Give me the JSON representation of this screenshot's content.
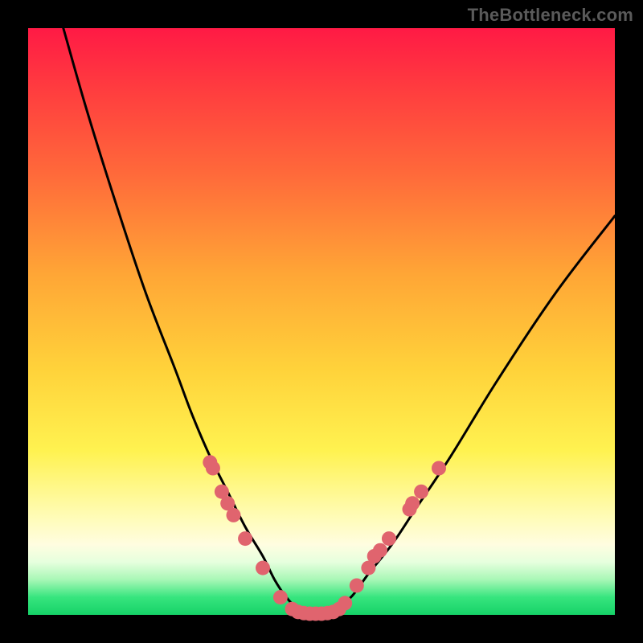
{
  "watermark": "TheBottleneck.com",
  "colors": {
    "background": "#000000",
    "dot": "#e0646e",
    "curve": "#000000"
  },
  "chart_data": {
    "type": "line",
    "title": "",
    "xlabel": "",
    "ylabel": "",
    "xlim": [
      0,
      100
    ],
    "ylim": [
      0,
      100
    ],
    "note": "No axis ticks or numeric labels are rendered in the image; values are visual-position estimates on a 0–100 scale.",
    "series": [
      {
        "name": "curve",
        "x": [
          6,
          10,
          15,
          20,
          25,
          28,
          31,
          34,
          37,
          40,
          42,
          44,
          46,
          48,
          50,
          52,
          55,
          58,
          62,
          66,
          72,
          80,
          90,
          100
        ],
        "y": [
          100,
          86,
          70,
          55,
          42,
          34,
          27,
          21,
          15,
          10,
          6,
          3,
          1,
          0,
          0,
          1,
          3,
          7,
          12,
          18,
          27,
          40,
          55,
          68
        ]
      }
    ],
    "markers": [
      {
        "x": 31,
        "y": 26
      },
      {
        "x": 31.5,
        "y": 25
      },
      {
        "x": 33,
        "y": 21
      },
      {
        "x": 34,
        "y": 19
      },
      {
        "x": 35,
        "y": 17
      },
      {
        "x": 37,
        "y": 13
      },
      {
        "x": 40,
        "y": 8
      },
      {
        "x": 43,
        "y": 3
      },
      {
        "x": 45,
        "y": 1
      },
      {
        "x": 46,
        "y": 0.5
      },
      {
        "x": 47,
        "y": 0.3
      },
      {
        "x": 48,
        "y": 0.2
      },
      {
        "x": 49,
        "y": 0.2
      },
      {
        "x": 50,
        "y": 0.2
      },
      {
        "x": 51,
        "y": 0.3
      },
      {
        "x": 52,
        "y": 0.5
      },
      {
        "x": 53,
        "y": 1
      },
      {
        "x": 54,
        "y": 2
      },
      {
        "x": 56,
        "y": 5
      },
      {
        "x": 58,
        "y": 8
      },
      {
        "x": 59,
        "y": 10
      },
      {
        "x": 60,
        "y": 11
      },
      {
        "x": 61.5,
        "y": 13
      },
      {
        "x": 65,
        "y": 18
      },
      {
        "x": 65.5,
        "y": 19
      },
      {
        "x": 67,
        "y": 21
      },
      {
        "x": 70,
        "y": 25
      }
    ]
  }
}
